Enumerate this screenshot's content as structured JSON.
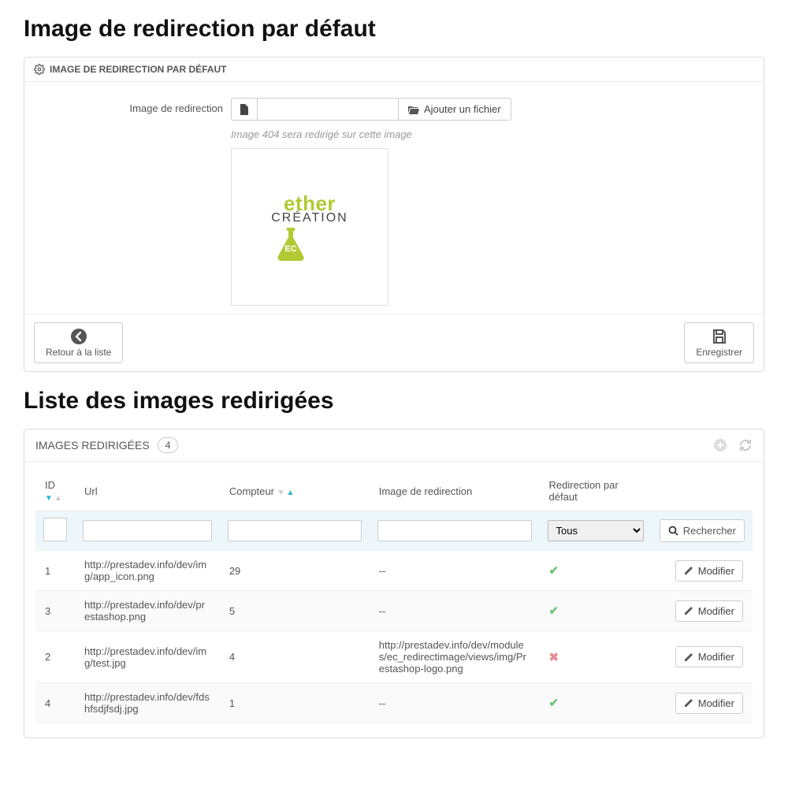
{
  "section1": {
    "title": "Image de redirection par défaut",
    "panel_title": "IMAGE DE REDIRECTION PAR DÉFAUT",
    "label": "Image de redirection",
    "file_value": "",
    "add_file": "Ajouter un fichier",
    "helper": "Image 404 sera redirigé sur cette image",
    "brand_top": "ether",
    "brand_sub": "CRÉATION",
    "flask_text": "EC",
    "back_label": "Retour à la liste",
    "save_label": "Enregistrer"
  },
  "section2": {
    "title": "Liste des images redirigées",
    "panel_title": "IMAGES REDIRIGÉES",
    "count": "4",
    "columns": {
      "id": "ID",
      "url": "Url",
      "counter": "Compteur",
      "image": "Image de redirection",
      "default": "Redirection par défaut"
    },
    "filter_default": "Tous",
    "search": "Rechercher",
    "modify": "Modifier",
    "rows": [
      {
        "id": "1",
        "url": "http://prestadev.info/dev/img/app_icon.png",
        "counter": "29",
        "image": "--",
        "default": true
      },
      {
        "id": "3",
        "url": "http://prestadev.info/dev/prestashop.png",
        "counter": "5",
        "image": "--",
        "default": true
      },
      {
        "id": "2",
        "url": "http://prestadev.info/dev/img/test.jpg",
        "counter": "4",
        "image": "http://prestadev.info/dev/modules/ec_redirectimage/views/img/Prestashop-logo.png",
        "default": false
      },
      {
        "id": "4",
        "url": "http://prestadev.info/dev/fdshfsdjfsdj.jpg",
        "counter": "1",
        "image": "--",
        "default": true
      }
    ]
  }
}
